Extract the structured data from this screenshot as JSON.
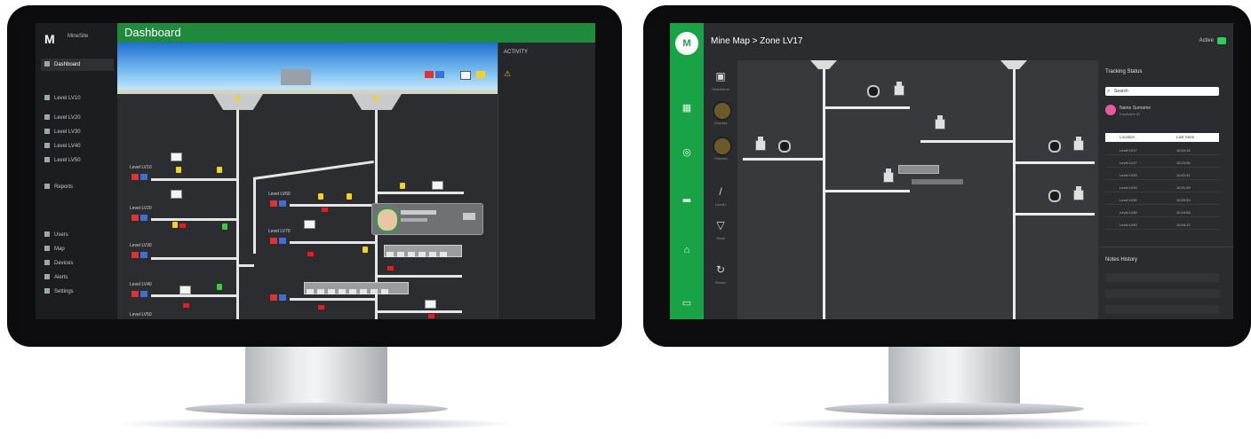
{
  "left_dashboard": {
    "header": {
      "title": "Dashboard"
    },
    "brand": {
      "logo": "M",
      "name": "MineSite"
    },
    "sidebar": {
      "items": [
        {
          "label": "Dashboard",
          "active": true
        },
        {
          "label": "Level LV10",
          "active": false
        },
        {
          "label": "Level LV20",
          "active": false
        },
        {
          "label": "Level LV30",
          "active": false
        },
        {
          "label": "Level LV40",
          "active": false
        },
        {
          "label": "Level LV50",
          "active": false
        },
        {
          "label": "Reports",
          "active": false
        },
        {
          "label": "Users",
          "active": false
        },
        {
          "label": "Map",
          "active": false
        },
        {
          "label": "Devices",
          "active": false
        },
        {
          "label": "Alerts",
          "active": false
        },
        {
          "label": "Settings",
          "active": false
        }
      ]
    },
    "right_panel": {
      "title": "ACTIVITY",
      "warning_icon": "warning-icon"
    },
    "levels": [
      "Level LV10",
      "Level LV20",
      "Level LV30",
      "Level LV40",
      "Level LV50",
      "Level LV60",
      "Level LV70"
    ],
    "colors": {
      "accent": "#1f8a3e",
      "alarm": "#d33333",
      "status_blue": "#3f6fd1",
      "lamp": "#f2d12a"
    }
  },
  "right_map": {
    "breadcrumb": "Mine Map > Zone LV17",
    "toggle_label": "Active",
    "nav_icons": [
      "map-icon",
      "layers-icon",
      "tag-icon",
      "truck-icon",
      "person-icon",
      "folder-icon"
    ],
    "tools": [
      "Headframe",
      "Orepass",
      "Orepass",
      "Ladder",
      "Shaft",
      "Rotate"
    ],
    "panel": {
      "title": "Tracking Status",
      "search_placeholder": "Search",
      "person_name": "Name Surname",
      "person_sub": "Employee ID",
      "table_headers": [
        "Location",
        "Last Seen"
      ],
      "rows": [
        [
          "Level LV17",
          "10:24:18"
        ],
        [
          "Level LV17",
          "10:23:56"
        ],
        [
          "Level LV20",
          "10:22:41"
        ],
        [
          "Level LV20",
          "10:21:09"
        ],
        [
          "Level LV30",
          "10:20:33"
        ],
        [
          "Level LV30",
          "10:19:58"
        ],
        [
          "Level LV40",
          "10:18:12"
        ]
      ],
      "section_title": "Notes History"
    },
    "colors": {
      "rail": "#19a347",
      "toggle": "#2fd05a"
    }
  }
}
